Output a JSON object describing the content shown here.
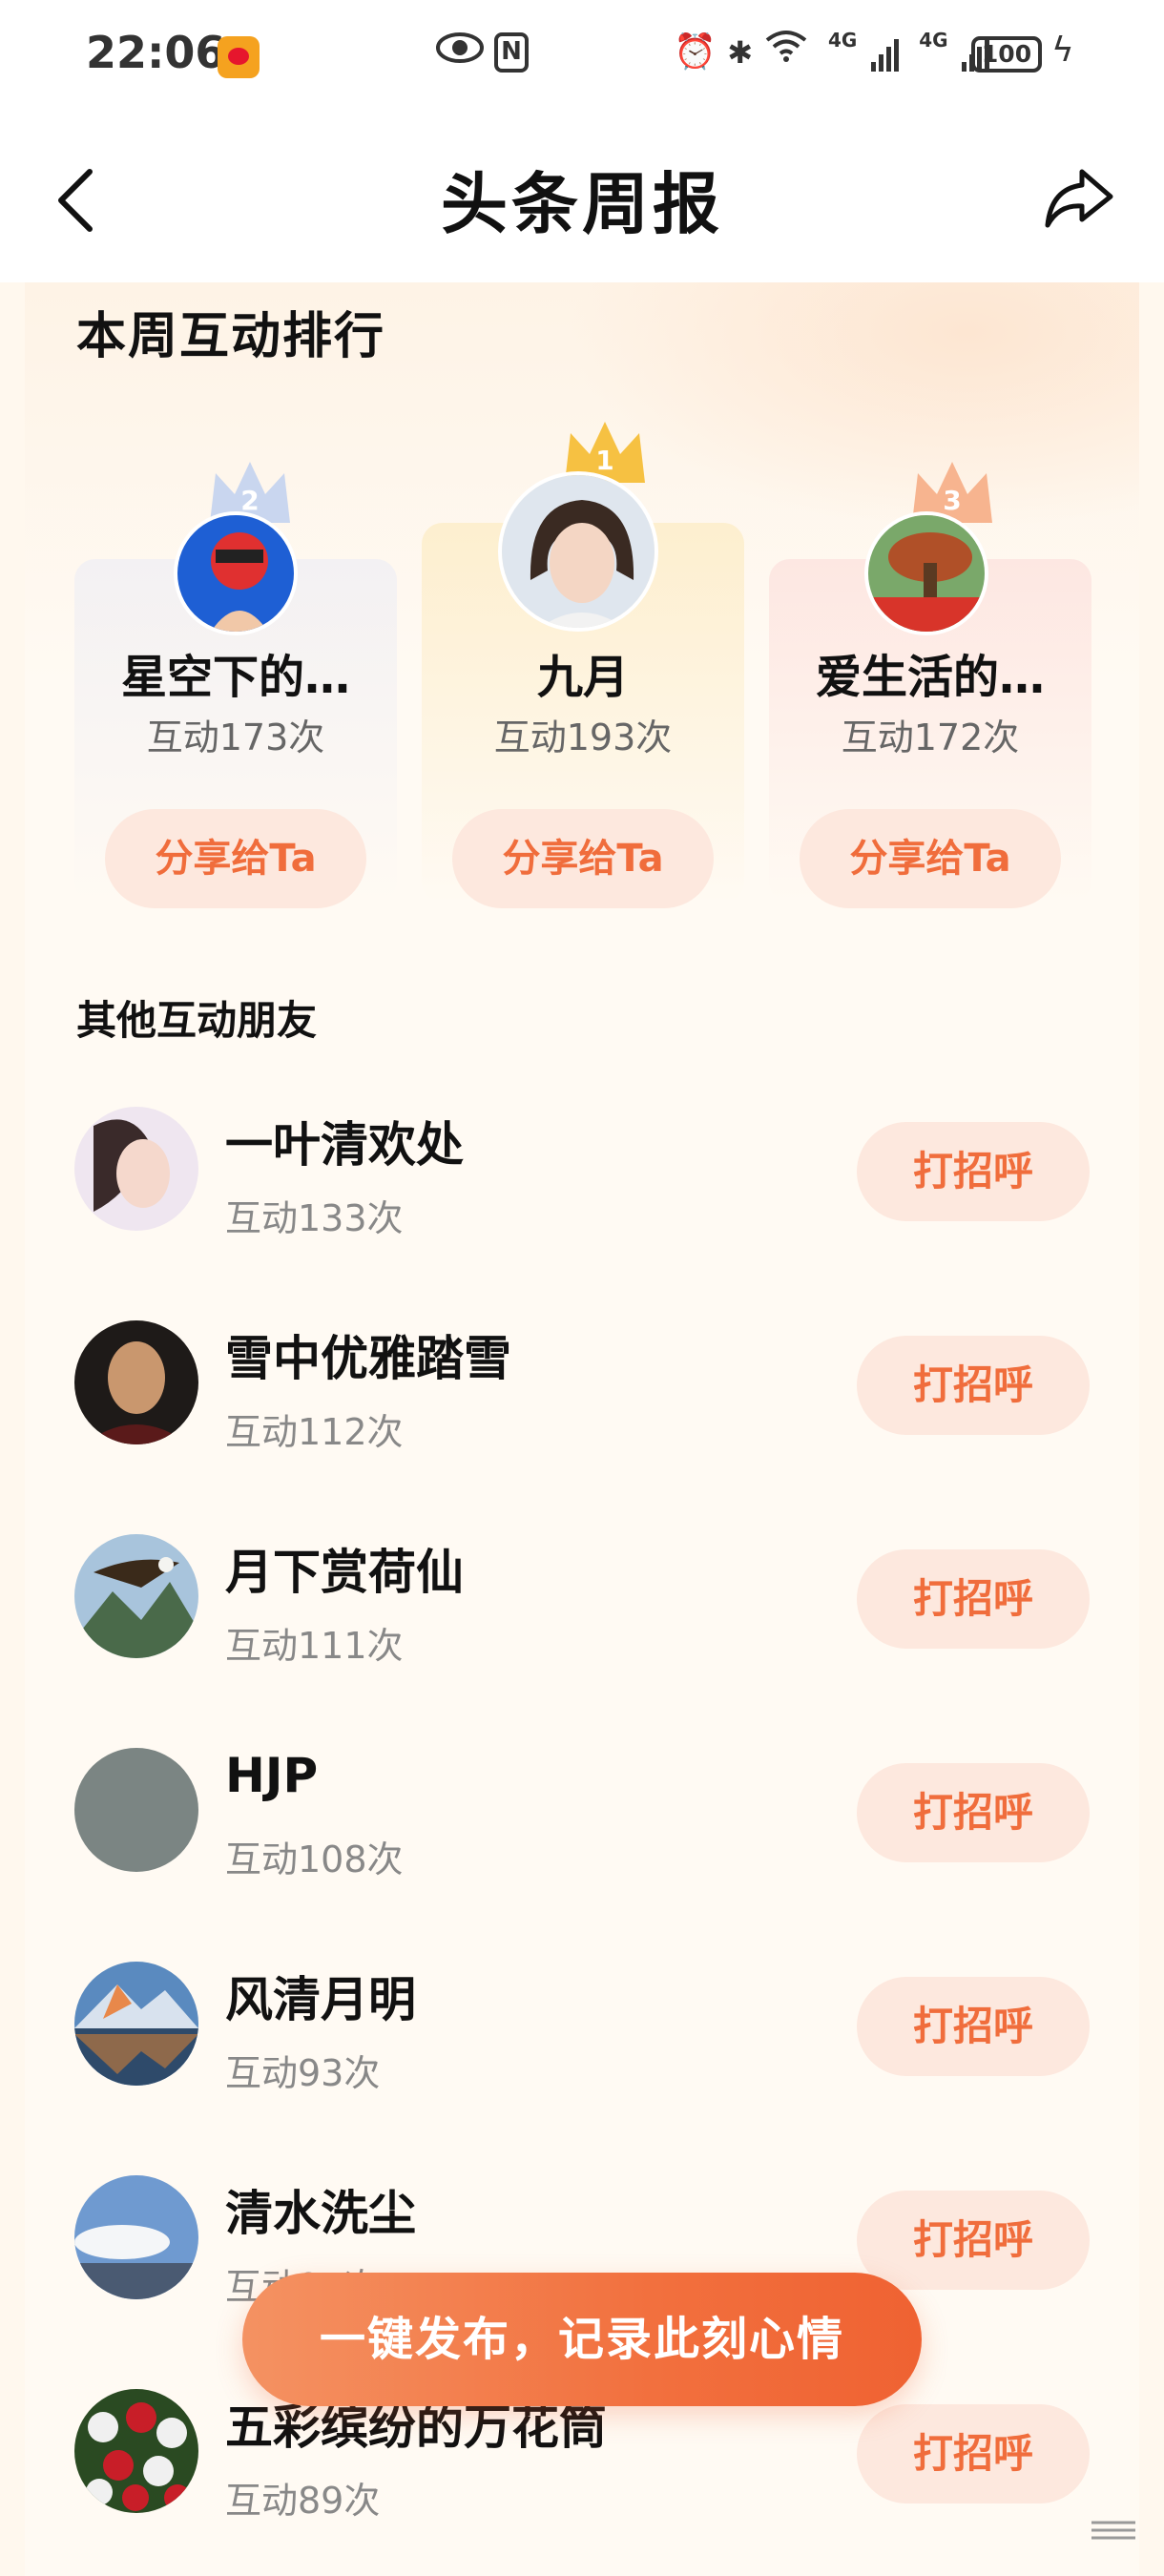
{
  "status_bar": {
    "time": "22:06",
    "net1": "4G",
    "net2": "4G",
    "battery": "100",
    "icons": [
      "weibo-app-icon",
      "eye-icon",
      "nfc-icon",
      "alarm-icon",
      "bluetooth-icon",
      "wifi-icon",
      "signal-icon",
      "battery-icon",
      "charging-icon"
    ]
  },
  "header": {
    "title": "头条周报",
    "back_icon": "chevron-left-icon",
    "share_icon": "share-arrow-icon"
  },
  "ranking": {
    "title": "本周互动排行",
    "top3": [
      {
        "rank": "2",
        "name": "星空下的…",
        "count": "互动173次",
        "button": "分享给Ta"
      },
      {
        "rank": "1",
        "name": "九月",
        "count": "互动193次",
        "button": "分享给Ta"
      },
      {
        "rank": "3",
        "name": "爱生活的…",
        "count": "互动172次",
        "button": "分享给Ta"
      }
    ]
  },
  "others": {
    "title": "其他互动朋友",
    "items": [
      {
        "name": "一叶清欢处",
        "count": "互动133次",
        "button": "打招呼"
      },
      {
        "name": "雪中优雅踏雪",
        "count": "互动112次",
        "button": "打招呼"
      },
      {
        "name": "月下赏荷仙",
        "count": "互动111次",
        "button": "打招呼"
      },
      {
        "name": "HJP",
        "count": "互动108次",
        "button": "打招呼"
      },
      {
        "name": "风清月明",
        "count": "互动93次",
        "button": "打招呼"
      },
      {
        "name": "清水洗尘",
        "count": "互动91次",
        "button": "打招呼"
      },
      {
        "name": "五彩缤纷的万花筒",
        "count": "互动89次",
        "button": "打招呼"
      }
    ]
  },
  "fab": {
    "label": "一键发布，记录此刻心情"
  },
  "colors": {
    "accent": "#f06d3c",
    "button_bg": "#fde8de",
    "page_bg": "#fff8ee",
    "gold": "#f6c142",
    "silver": "#c9d6ef",
    "bronze": "#f7b48f"
  }
}
